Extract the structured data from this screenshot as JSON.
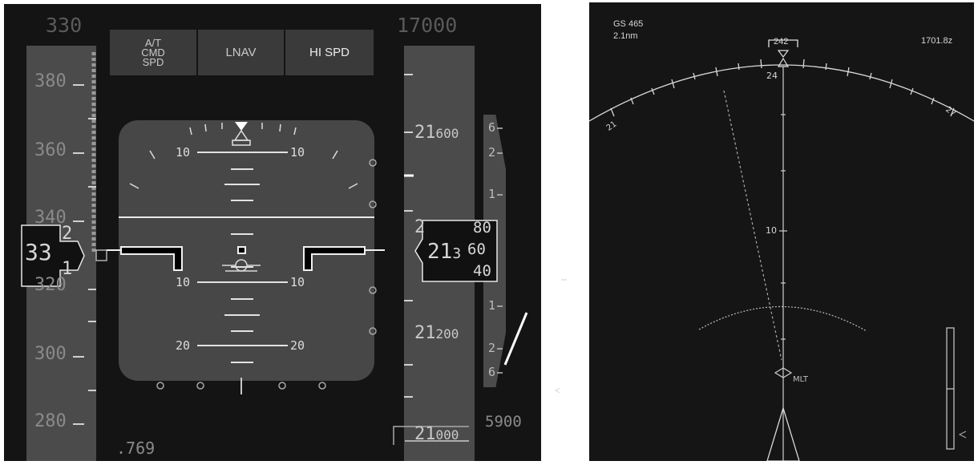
{
  "pfd": {
    "selected_speed": "330",
    "selected_altitude": "17000",
    "mach": ".769",
    "vertical_speed_selected": "5900",
    "fma": {
      "autothrottle": "A/T",
      "cmd": "CMD",
      "spd": "SPD",
      "lateral_mode": "LNAV",
      "vertical_mode": "HI SPD"
    },
    "speed_tape": {
      "labels": [
        "380",
        "360",
        "340",
        "320",
        "300",
        "280"
      ]
    },
    "speed_readout": {
      "main": "33",
      "upper_digit": "2",
      "lower_digit": "1"
    },
    "altitude_tape": {
      "labels": [
        {
          "big": "21",
          "small": "600"
        },
        {
          "big": "21",
          "small": "200"
        },
        {
          "big": "21",
          "small": "000"
        }
      ]
    },
    "altitude_readout": {
      "big": "21",
      "mid": "3",
      "roll_top": "80",
      "roll_mid": "60",
      "roll_bot": "40",
      "tape_partial": "2"
    },
    "vsi": {
      "labels": [
        "6",
        "2",
        "1",
        "1",
        "2",
        "6"
      ]
    },
    "attitude": {
      "pitch_labels": {
        "up10_left": "10",
        "up10_right": "10",
        "dn10_left": "10",
        "dn10_right": "10",
        "dn20_left": "20",
        "dn20_right": "20"
      }
    }
  },
  "nd": {
    "ground_speed": "GS 465",
    "distance": "2.1nm",
    "time": "1701.8z",
    "heading": "242",
    "compass_labels": {
      "left": "21",
      "center": "24",
      "right": "27"
    },
    "range_label": "10",
    "waypoint": "MLT"
  },
  "colors": {
    "background": "#141414",
    "tape": "#4b4b4b",
    "attitude_box": "#474747",
    "text_white": "#e6e6e6",
    "text_grey": "#8a8a8a"
  }
}
